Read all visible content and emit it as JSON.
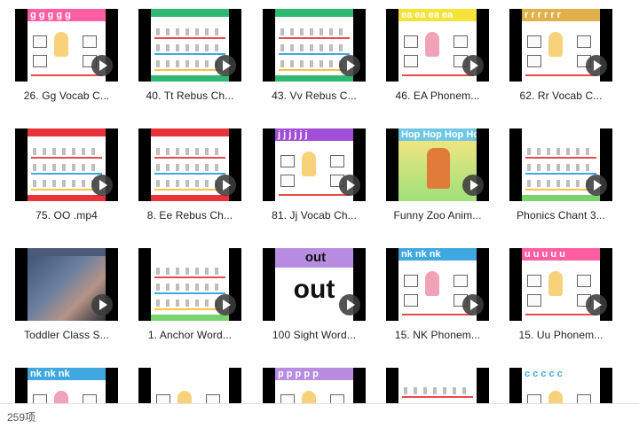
{
  "files": [
    {
      "caption": "26. Gg Vocab C...",
      "band_color": "#ff5fa2",
      "band_text": "g g g g g",
      "theme": "vocab"
    },
    {
      "caption": "40. Tt Rebus Ch...",
      "band_color": "#2eb872",
      "band_text": "",
      "theme": "rebus",
      "rebus_chars": "t 10  t  t"
    },
    {
      "caption": "43. Vv Rebus C...",
      "band_color": "#2eb872",
      "band_text": "",
      "theme": "rebus",
      "rebus_chars": "v v  5  v v"
    },
    {
      "caption": "46. EA Phonem...",
      "band_color": "#f6e33a",
      "band_text": "ea  ea  ea  ea",
      "theme": "phonemes"
    },
    {
      "caption": "62. Rr Vocab C...",
      "band_color": "#e0b14a",
      "band_text": "r r r r r r",
      "theme": "vocab"
    },
    {
      "caption": "75. OO .mp4",
      "band_color": "#e8323c",
      "band_text": "",
      "theme": "rebus",
      "rebus_chars": "oo oo oo"
    },
    {
      "caption": "8. Ee Rebus Ch...",
      "band_color": "#e8323c",
      "band_text": "",
      "theme": "rebus",
      "rebus_chars": "e  e  e  e"
    },
    {
      "caption": "81. Jj Vocab Ch...",
      "band_color": "#a14fd6",
      "band_text": "j j j j j j",
      "theme": "vocab"
    },
    {
      "caption": "Funny Zoo Anim...",
      "band_color": "#6fc7e6",
      "band_text": "Hop Hop Hop Hop",
      "theme": "zoo"
    },
    {
      "caption": "Phonics Chant 3...",
      "band_color": "#ffffff",
      "band_text": "",
      "theme": "chant",
      "rebus_chars": "th th  th th"
    },
    {
      "caption": "Toddler Class S...",
      "band_color": "#4a5b7a",
      "band_text": "",
      "theme": "photo"
    },
    {
      "caption": "1. Anchor Word...",
      "band_color": "#ffffff",
      "band_text": "",
      "theme": "chant",
      "rebus_chars": "th th  ng ng"
    },
    {
      "caption": "100 Sight Word...",
      "band_color": "#b88ce0",
      "band_text": "out",
      "theme": "sight",
      "big_word": "out"
    },
    {
      "caption": "15. NK Phonem...",
      "band_color": "#3fa8e0",
      "band_text": "nk nk nk",
      "theme": "phonemes"
    },
    {
      "caption": "15. Uu Phonem...",
      "band_color": "#ff5fa2",
      "band_text": "u u u u u",
      "theme": "vocab"
    },
    {
      "caption": "",
      "band_color": "#3fa8e0",
      "band_text": "nk nk nk",
      "theme": "phonemes"
    },
    {
      "caption": "",
      "band_color": "#ffffff",
      "band_text": "",
      "theme": "vocab"
    },
    {
      "caption": "",
      "band_color": "#b88ce0",
      "band_text": "p p p p p",
      "theme": "vocab"
    },
    {
      "caption": "",
      "band_color": "#ffffff",
      "band_text": "",
      "theme": "chant",
      "rebus_chars": "th th"
    },
    {
      "caption": "",
      "band_color": "#ffffff",
      "band_text": "c c c c c",
      "theme": "vocab"
    }
  ],
  "status": {
    "item_count": "259项"
  },
  "colors": {
    "thumb_border": "#000000",
    "play_button": "#3c3c3c",
    "caption_text": "#222222"
  },
  "icons": {
    "play": "play-icon"
  }
}
